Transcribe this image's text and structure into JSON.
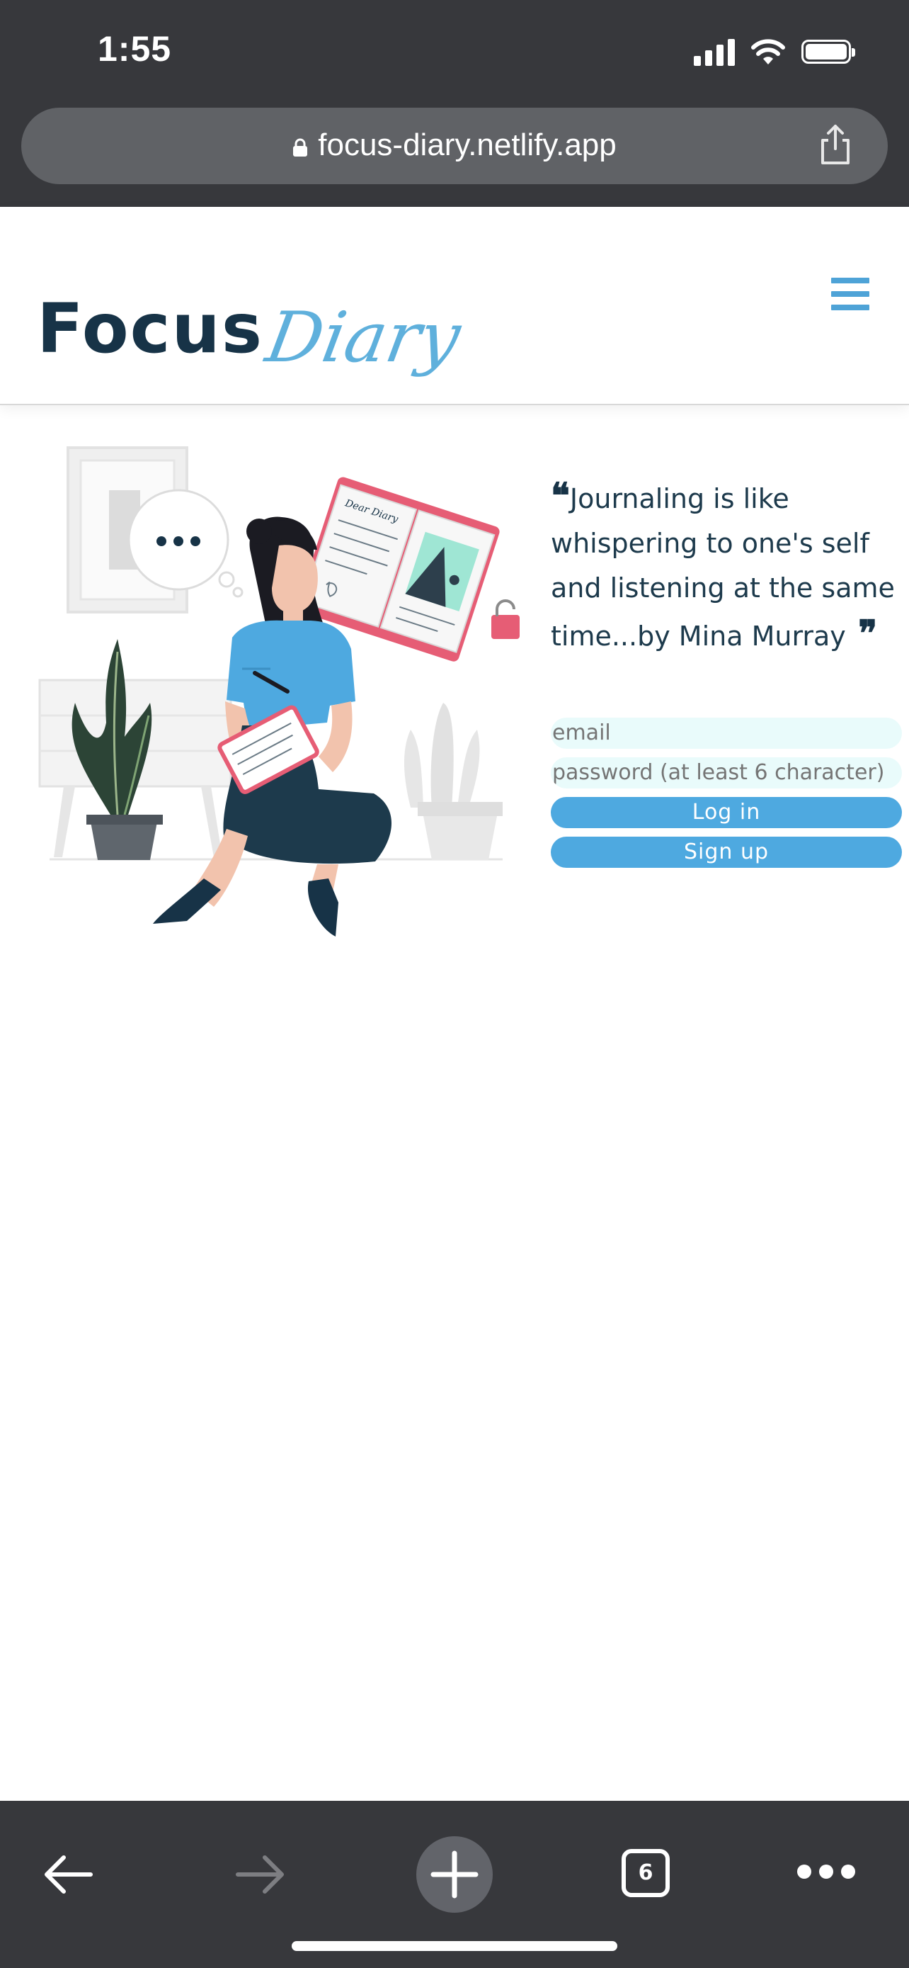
{
  "status_bar": {
    "time": "1:55"
  },
  "browser": {
    "url": "focus-diary.netlify.app",
    "open_tabs": "6"
  },
  "header": {
    "logo_primary": "Focus",
    "logo_secondary": "Diary"
  },
  "quote": {
    "text": "Journaling is like whispering to one's self and listening at the same time...by Mina Murray"
  },
  "login_form": {
    "email_placeholder": "email",
    "password_placeholder": "password (at least 6 character)",
    "login_label": "Log in",
    "signup_label": "Sign up"
  },
  "illustration": {
    "notebook_title": "Dear Diary"
  },
  "colors": {
    "brand_dark": "#173347",
    "brand_light": "#5fb0dc",
    "button": "#4ea9e0",
    "input_bg": "#e9fbfb",
    "chrome": "#37383c"
  }
}
